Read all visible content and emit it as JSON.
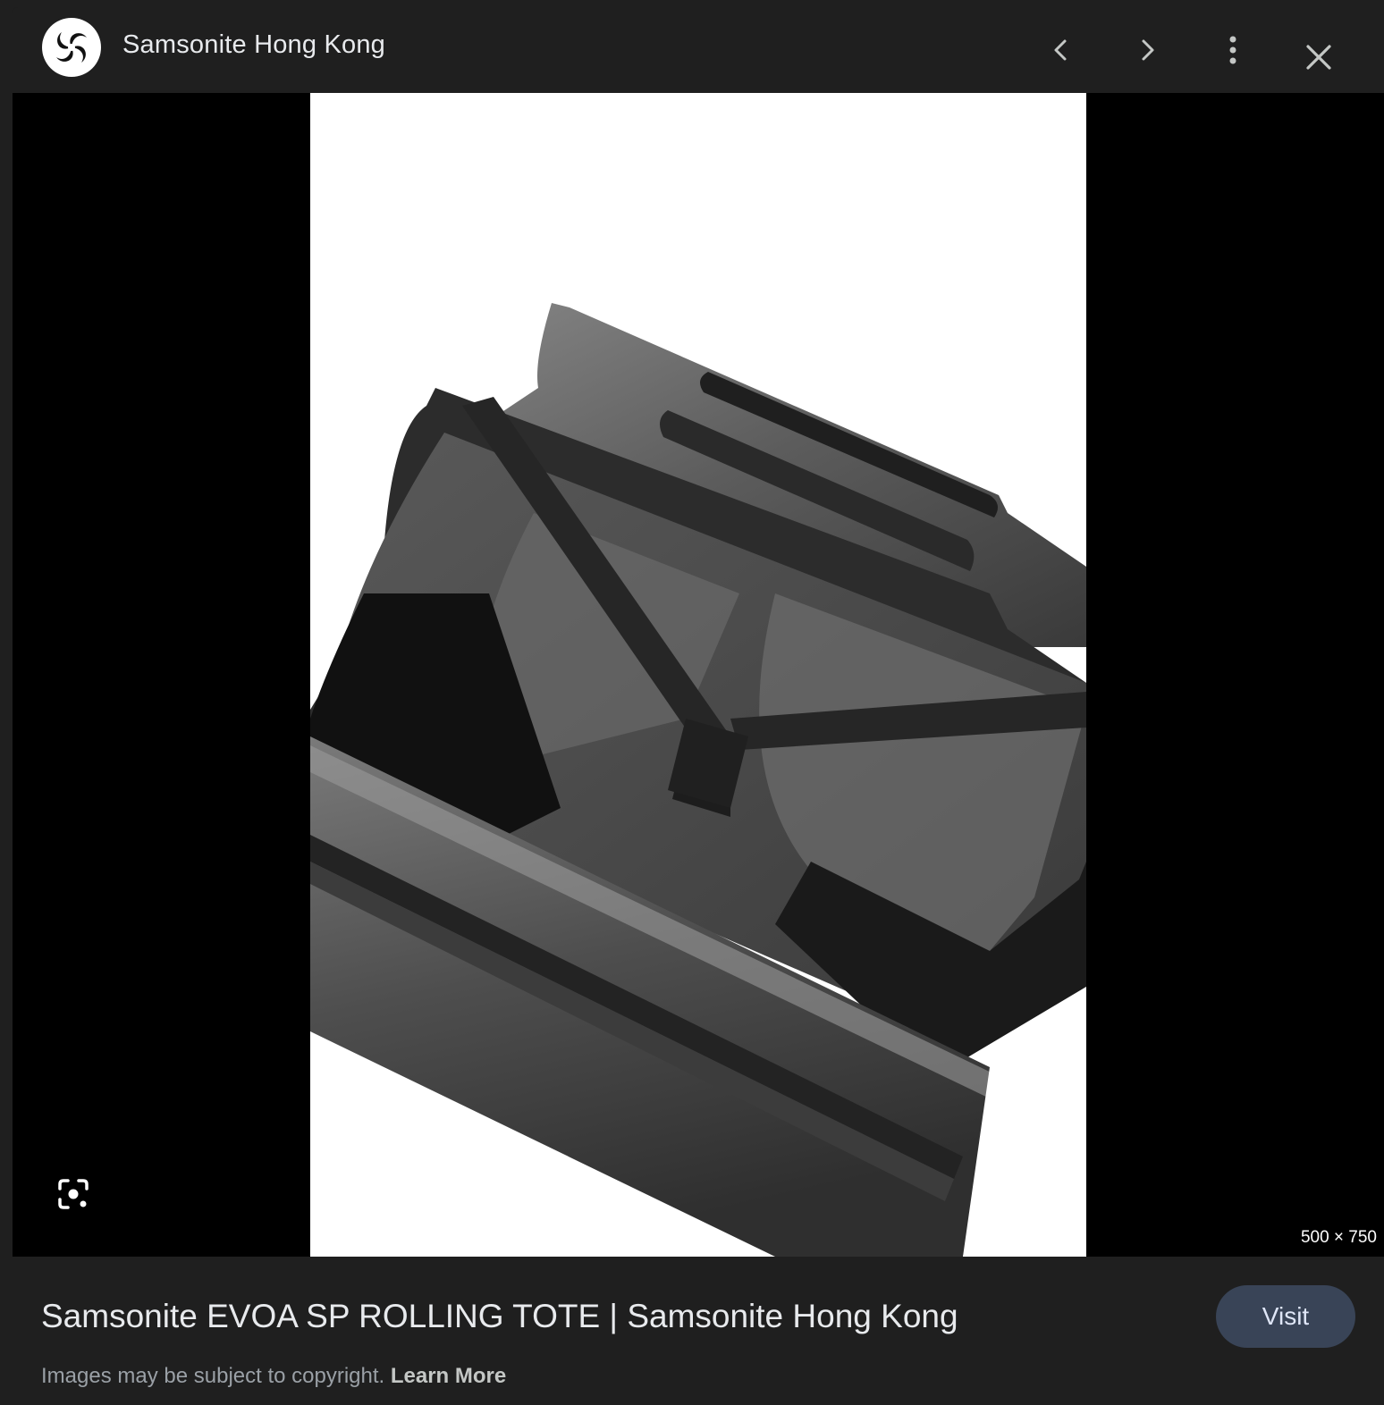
{
  "header": {
    "site_name": "Samsonite Hong Kong",
    "logo_icon": "samsonite-swirl-icon",
    "prev_icon": "chevron-left-icon",
    "next_icon": "chevron-right-icon",
    "more_icon": "more-vertical-icon",
    "close_icon": "close-icon"
  },
  "viewer": {
    "image_subject": "open grey hardshell rolling tote suitcase, product photo",
    "dimensions": "500 × 750",
    "lens_icon": "google-lens-icon"
  },
  "footer": {
    "title": "Samsonite EVOA SP ROLLING TOTE | Samsonite Hong Kong",
    "visit_label": "Visit",
    "copyright_text": "Images may be subject to copyright.",
    "learn_more_label": "Learn More"
  },
  "colors": {
    "background": "#1f1f1f",
    "viewer_background": "#000000",
    "visit_button": "#394457",
    "text_primary": "#e8eaed",
    "text_secondary": "#9aa0a6"
  }
}
